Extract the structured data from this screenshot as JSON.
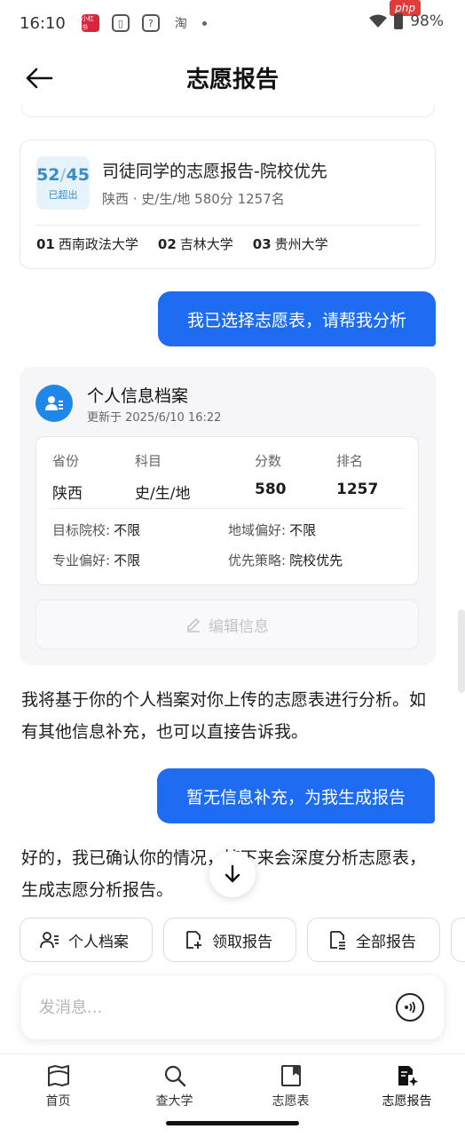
{
  "status_bar": {
    "time": "16:10",
    "icons": [
      "小红书",
      "clipboard-icon",
      "question-icon",
      "taobao-icon"
    ],
    "taobao_glyph": "淘",
    "battery": "98%",
    "watermark": "php"
  },
  "header": {
    "title": "志愿报告"
  },
  "report_card": {
    "score": "52",
    "score_total": "45",
    "score_label": "已超出",
    "title": "司徒同学的志愿报告-院校优先",
    "subtitle": "陕西 · 史/生/地 580分 1257名",
    "universities": [
      {
        "num": "01",
        "name": "西南政法大学"
      },
      {
        "num": "02",
        "name": "吉林大学"
      },
      {
        "num": "03",
        "name": "贵州大学"
      }
    ]
  },
  "messages": {
    "user_1": "我已选择志愿表，请帮我分析",
    "bot_1": "我将基于你的个人档案对你上传的志愿表进行分析。如有其他信息补充，也可以直接告诉我。",
    "user_2": "暂无信息补充，为我生成报告",
    "bot_2": "好的，我已确认你的情况，接下来会深度分析志愿表，生成志愿分析报告。"
  },
  "profile": {
    "title": "个人信息档案",
    "updated": "更新于 2025/6/10 16:22",
    "fields": [
      {
        "key": "省份",
        "value": "陕西"
      },
      {
        "key": "科目",
        "value": "史/生/地"
      },
      {
        "key": "分数",
        "value": "580"
      },
      {
        "key": "排名",
        "value": "1257"
      }
    ],
    "prefs": [
      {
        "key": "目标院校:",
        "value": "不限"
      },
      {
        "key": "地域偏好:",
        "value": "不限"
      },
      {
        "key": "专业偏好:",
        "value": "不限"
      },
      {
        "key": "优先策略:",
        "value": "院校优先"
      }
    ],
    "edit_label": "编辑信息"
  },
  "quick_actions": [
    {
      "label": "个人档案",
      "icon": "person-list-icon"
    },
    {
      "label": "领取报告",
      "icon": "doc-add-icon"
    },
    {
      "label": "全部报告",
      "icon": "doc-list-icon"
    }
  ],
  "composer": {
    "placeholder": "发消息..."
  },
  "bottom_nav": [
    {
      "label": "首页",
      "icon": "map-book-icon"
    },
    {
      "label": "查大学",
      "icon": "search-icon"
    },
    {
      "label": "志愿表",
      "icon": "doc-tab-icon"
    },
    {
      "label": "志愿报告",
      "icon": "report-spark-icon",
      "active": true
    }
  ],
  "colors": {
    "accent": "#1e6cf2",
    "avatar": "#1f87ea",
    "score": "#3a8dc2"
  }
}
